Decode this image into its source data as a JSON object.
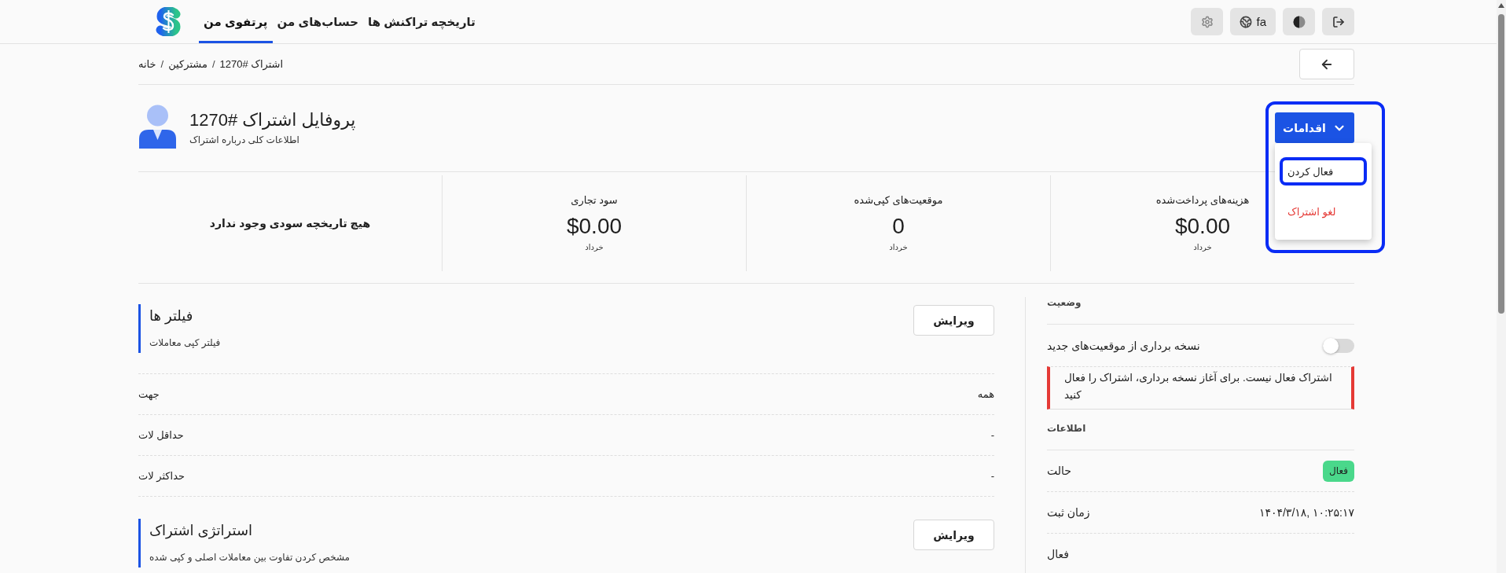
{
  "top_nav": {
    "nav_items": [
      {
        "label": "تاریخچه تراکنش ها",
        "selected": false
      },
      {
        "label": "حساب‌های من",
        "selected": false
      },
      {
        "label": "پرتفوی من",
        "selected": true
      }
    ],
    "toolbar_buttons": [
      {
        "kind": "settings"
      },
      {
        "kind": "language",
        "label": "fa"
      },
      {
        "kind": "theme"
      },
      {
        "kind": "logout"
      }
    ]
  },
  "breadcrumb": {
    "items": [
      "اشتراک #1270",
      "مشترکین",
      "خانه"
    ],
    "separator": "/"
  },
  "header": {
    "title": "پروفایل اشتراک #1270",
    "subtitle": "اطلاعات کلی درباره اشتراک"
  },
  "actions": {
    "label": "اقدامات",
    "expanded": true,
    "highlighted": true,
    "menu": [
      {
        "label": "فعال کردن",
        "kind": "normal",
        "focused": true
      },
      {
        "label": "لغو اشتراک",
        "kind": "danger",
        "focused": false
      }
    ]
  },
  "stats": [
    {
      "kind": "stat",
      "label": "هزینه‌های پرداخت‌شده",
      "value": "$0.00",
      "period": "خرداد"
    },
    {
      "kind": "stat",
      "label": "موقعیت‌های کپی‌شده",
      "value": "0",
      "period": "خرداد"
    },
    {
      "kind": "stat",
      "label": "سود تجاری",
      "value": "$0.00",
      "period": "خرداد"
    },
    {
      "kind": "empty",
      "text": "هیچ تاریخچه سودی وجود ندارد"
    }
  ],
  "sections": [
    {
      "title": "فیلتر ها",
      "subtitle": "فیلتر کپی معاملات",
      "button": "ویرایش",
      "rows": [
        {
          "label": "جهت",
          "value": "همه"
        },
        {
          "label": "حداقل لات",
          "value": "-"
        },
        {
          "label": "حداکثر لات",
          "value": "-"
        }
      ]
    },
    {
      "title": "استراتژی اشتراک",
      "subtitle": "مشخص کردن تفاوت بین معاملات اصلی و کپی شده",
      "button": "ویرایش"
    }
  ],
  "side_panel": {
    "status": {
      "heading": "وضعیت",
      "toggle": {
        "label": "نسخه برداری از موقعیت‌های جدید",
        "on": false
      },
      "alert": "اشتراک فعال نیست. برای آغاز نسخه برداری، اشتراک را فعال کنید"
    },
    "info": {
      "heading": "اطلاعات",
      "rows": [
        {
          "label": "حالت",
          "kind": "badge",
          "value": "فعال"
        },
        {
          "label": "زمان ثبت",
          "kind": "text",
          "value": "۱۴۰۴/۳/۱۸, ۱۰:۲۵:۱۷"
        },
        {
          "label": "فعال",
          "kind": "text"
        }
      ]
    }
  }
}
